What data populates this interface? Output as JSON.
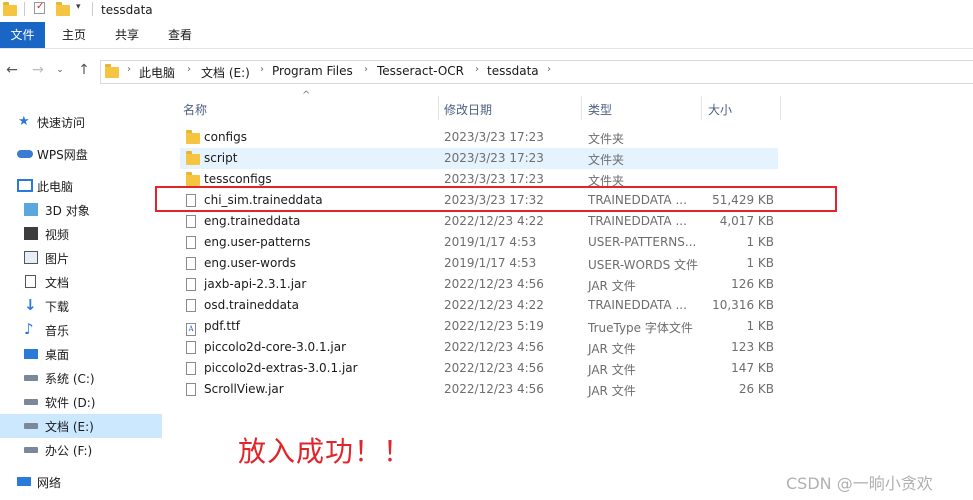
{
  "window": {
    "title": "tessdata"
  },
  "ribbon": {
    "tabs": [
      "文件",
      "主页",
      "共享",
      "查看"
    ]
  },
  "address": {
    "crumbs": [
      "此电脑",
      "文档 (E:)",
      "Program Files",
      "Tesseract-OCR",
      "tessdata"
    ]
  },
  "sidebar": {
    "items": [
      {
        "label": "快速访问",
        "icon": "star-icon"
      },
      {
        "label": "WPS网盘",
        "icon": "cloud-icon"
      },
      {
        "label": "此电脑",
        "icon": "computer-icon"
      },
      {
        "label": "3D 对象",
        "icon": "cube-icon"
      },
      {
        "label": "视频",
        "icon": "video-icon"
      },
      {
        "label": "图片",
        "icon": "picture-icon"
      },
      {
        "label": "文档",
        "icon": "document-icon"
      },
      {
        "label": "下载",
        "icon": "download-icon"
      },
      {
        "label": "音乐",
        "icon": "music-icon"
      },
      {
        "label": "桌面",
        "icon": "desktop-icon"
      },
      {
        "label": "系统 (C:)",
        "icon": "drive-icon"
      },
      {
        "label": "软件 (D:)",
        "icon": "drive-icon"
      },
      {
        "label": "文档 (E:)",
        "icon": "drive-icon"
      },
      {
        "label": "办公 (F:)",
        "icon": "drive-icon"
      },
      {
        "label": "网络",
        "icon": "network-icon"
      }
    ]
  },
  "columns": {
    "name": "名称",
    "date": "修改日期",
    "type": "类型",
    "size": "大小"
  },
  "files": [
    {
      "name": "configs",
      "date": "2023/3/23 17:23",
      "type": "文件夹",
      "size": "",
      "kind": "folder"
    },
    {
      "name": "script",
      "date": "2023/3/23 17:23",
      "type": "文件夹",
      "size": "",
      "kind": "folder"
    },
    {
      "name": "tessconfigs",
      "date": "2023/3/23 17:23",
      "type": "文件夹",
      "size": "",
      "kind": "folder"
    },
    {
      "name": "chi_sim.traineddata",
      "date": "2023/3/23 17:32",
      "type": "TRAINEDDATA ...",
      "size": "51,429 KB",
      "kind": "file"
    },
    {
      "name": "eng.traineddata",
      "date": "2022/12/23 4:22",
      "type": "TRAINEDDATA ...",
      "size": "4,017 KB",
      "kind": "file"
    },
    {
      "name": "eng.user-patterns",
      "date": "2019/1/17 4:53",
      "type": "USER-PATTERNS...",
      "size": "1 KB",
      "kind": "file"
    },
    {
      "name": "eng.user-words",
      "date": "2019/1/17 4:53",
      "type": "USER-WORDS 文件",
      "size": "1 KB",
      "kind": "file"
    },
    {
      "name": "jaxb-api-2.3.1.jar",
      "date": "2022/12/23 4:56",
      "type": "JAR 文件",
      "size": "126 KB",
      "kind": "file"
    },
    {
      "name": "osd.traineddata",
      "date": "2022/12/23 4:22",
      "type": "TRAINEDDATA ...",
      "size": "10,316 KB",
      "kind": "file"
    },
    {
      "name": "pdf.ttf",
      "date": "2022/12/23 5:19",
      "type": "TrueType 字体文件",
      "size": "1 KB",
      "kind": "ttf"
    },
    {
      "name": "piccolo2d-core-3.0.1.jar",
      "date": "2022/12/23 4:56",
      "type": "JAR 文件",
      "size": "123 KB",
      "kind": "file"
    },
    {
      "name": "piccolo2d-extras-3.0.1.jar",
      "date": "2022/12/23 4:56",
      "type": "JAR 文件",
      "size": "147 KB",
      "kind": "file"
    },
    {
      "name": "ScrollView.jar",
      "date": "2022/12/23 4:56",
      "type": "JAR 文件",
      "size": "26 KB",
      "kind": "file"
    }
  ],
  "annotation": {
    "text": "放入成功！！"
  },
  "watermark": {
    "text": "CSDN @一晌小贪欢"
  },
  "colors": {
    "accent": "#1a66c7",
    "highlight": "#e0252b",
    "selected": "#cce8ff",
    "folder": "#f5c542"
  }
}
